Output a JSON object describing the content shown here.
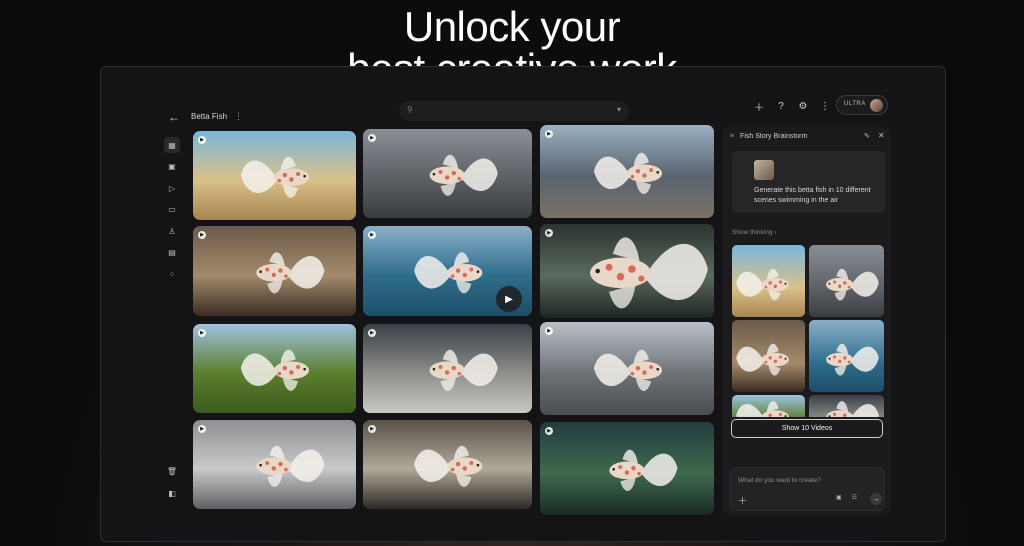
{
  "hero": {
    "line1": "Unlock your",
    "line2": "best creative work"
  },
  "header": {
    "title": "Betta Fish",
    "search_placeholder": "",
    "plan_badge": "ULTRA"
  },
  "sidebar": {
    "items": [
      {
        "name": "grid-icon",
        "glyph": "▦"
      },
      {
        "name": "image-icon",
        "glyph": "▣"
      },
      {
        "name": "video-icon",
        "glyph": "▷"
      },
      {
        "name": "calendar-icon",
        "glyph": "▭"
      },
      {
        "name": "person-icon",
        "glyph": "♙"
      },
      {
        "name": "folder-icon",
        "glyph": "▤"
      },
      {
        "name": "apps-icon",
        "glyph": "⁘"
      }
    ],
    "bottom": [
      {
        "name": "trash-icon",
        "glyph": "🗑"
      },
      {
        "name": "panel-icon",
        "glyph": "◧"
      }
    ]
  },
  "grid": {
    "tiles": [
      {
        "name": "beach",
        "bg": [
          "#7bb7d8",
          "#d9c089",
          "#a8864f"
        ]
      },
      {
        "name": "mirror-street",
        "bg": [
          "#8a8f96",
          "#5d6166",
          "#3a3d40"
        ]
      },
      {
        "name": "harbor-wall",
        "bg": [
          "#9ab0c2",
          "#5a6470",
          "#7a7066"
        ]
      },
      {
        "name": "sushi-counter",
        "bg": [
          "#6b5a4a",
          "#a48a6c",
          "#3a2c22"
        ]
      },
      {
        "name": "ocean",
        "bg": [
          "#8ab0c8",
          "#2f6d8d",
          "#1e4e68"
        ]
      },
      {
        "name": "closeup",
        "bg": [
          "#2a3430",
          "#5b6a5e",
          "#1e2624"
        ]
      },
      {
        "name": "lawn",
        "bg": [
          "#9fc2e0",
          "#5c7f2e",
          "#3d5a1c"
        ]
      },
      {
        "name": "market",
        "bg": [
          "#3a4048",
          "#8e8e8a",
          "#c9c9c4"
        ]
      },
      {
        "name": "balcony",
        "bg": [
          "#b9c0c8",
          "#6e7378",
          "#4a4d50"
        ]
      },
      {
        "name": "car",
        "bg": [
          "#8e9093",
          "#c8c9ca",
          "#5d5f62"
        ]
      },
      {
        "name": "table",
        "bg": [
          "#5a524a",
          "#b0a898",
          "#2c2824"
        ]
      },
      {
        "name": "aquarium",
        "bg": [
          "#233d3f",
          "#3f6a4c",
          "#1a2a24"
        ]
      }
    ]
  },
  "panel": {
    "title": "Fish Story Brainstorm",
    "prompt": "Generate this betta fish in 10 different scenes swimming in the air",
    "thinking": "Show thinking ›",
    "show_button": "Show 10 Videos",
    "composer_placeholder": "What do you want to create?"
  },
  "colors": {
    "fish_body": "#e8d8c8",
    "fish_spots": "#d8685a",
    "fins": "#f4f1ec"
  }
}
